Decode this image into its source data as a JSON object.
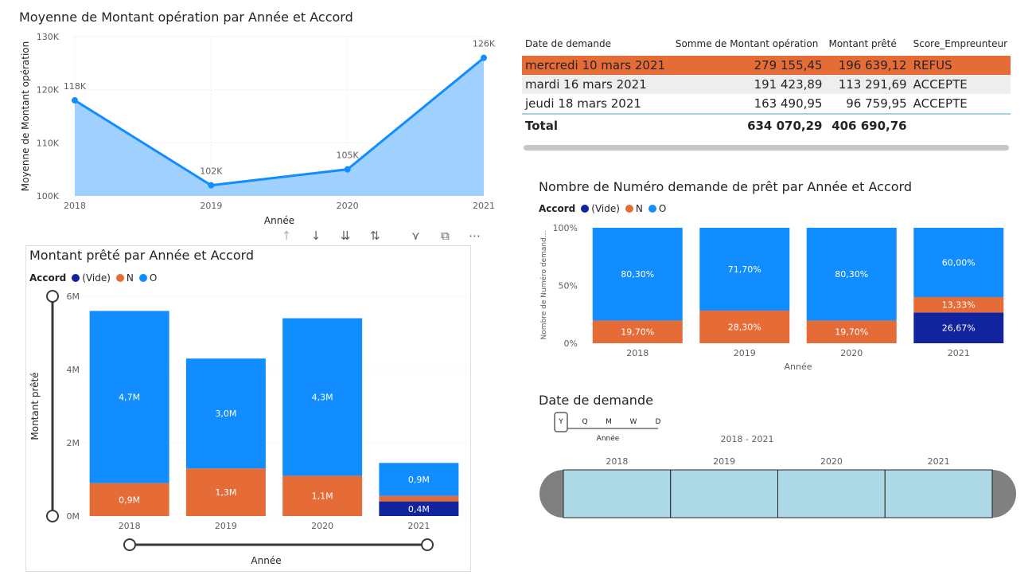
{
  "colors": {
    "series_o": "#118dff",
    "series_n": "#e66c37",
    "series_vide": "#12239e",
    "area_fill": "#9fd0fe",
    "line": "#118dff",
    "highlight_row": "#e66c37",
    "alt_row": "#eeeeee",
    "timeline_fill": "#add8e6"
  },
  "line_chart": {
    "title": "Moyenne de Montant opération par Année et Accord",
    "chart_data": {
      "type": "area",
      "title": "Moyenne de Montant opération par Année et Accord",
      "xlabel": "Année",
      "ylabel": "Moyenne de Montant opération",
      "x": [
        "2018",
        "2019",
        "2020",
        "2021"
      ],
      "values": [
        118000,
        102000,
        105000,
        126000
      ],
      "data_labels": [
        "118K",
        "102K",
        "105K",
        "126K"
      ],
      "y_ticks": [
        "100K",
        "110K",
        "120K",
        "130K"
      ],
      "ylim": [
        100000,
        130000
      ],
      "grid": true
    }
  },
  "matrix": {
    "headers": [
      "Date de demande",
      "Somme de Montant opération",
      "Montant prêté",
      "Score_Empreunteur"
    ],
    "rows": [
      {
        "date": "mercredi 10 mars 2021",
        "somme": "279 155,45",
        "prete": "196 639,12",
        "score": "REFUS"
      },
      {
        "date": "mardi 16 mars 2021",
        "somme": "191 423,89",
        "prete": "113 291,69",
        "score": "ACCEPTE"
      },
      {
        "date": "jeudi 18 mars 2021",
        "somme": "163 490,95",
        "prete": "96 759,95",
        "score": "ACCEPTE"
      }
    ],
    "total": {
      "label": "Total",
      "somme": "634 070,29",
      "prete": "406 690,76"
    }
  },
  "bar_chart": {
    "title": "Montant prêté par Année et Accord",
    "legend": {
      "title": "Accord",
      "items": [
        "(Vide)",
        "N",
        "O"
      ]
    },
    "toolbar_icons": [
      "drill-up-icon",
      "drill-down-icon",
      "expand-all-icon",
      "expand-hierarchy-icon",
      "filter-icon",
      "focus-mode-icon",
      "more-options-icon"
    ],
    "chart_data": {
      "type": "bar",
      "stacked": true,
      "title": "Montant prêté par Année et Accord",
      "xlabel": "Année",
      "ylabel": "Montant prêté",
      "categories": [
        "2018",
        "2019",
        "2020",
        "2021"
      ],
      "series": [
        {
          "name": "(Vide)",
          "values": [
            0,
            0,
            0,
            0.4
          ],
          "labels": [
            "",
            "",
            "",
            "0,4M"
          ]
        },
        {
          "name": "N",
          "values": [
            0.9,
            1.3,
            1.1,
            0.15
          ],
          "labels": [
            "0,9M",
            "1,3M",
            "1,1M",
            ""
          ]
        },
        {
          "name": "O",
          "values": [
            4.7,
            3.0,
            4.3,
            0.9
          ],
          "labels": [
            "4,7M",
            "3,0M",
            "4,3M",
            "0,9M"
          ]
        }
      ],
      "y_ticks": [
        "0M",
        "2M",
        "4M",
        "6M"
      ],
      "ylim": [
        0,
        6
      ],
      "grid": true
    }
  },
  "pct_chart": {
    "title": "Nombre de Numéro demande de prêt par Année et Accord",
    "legend": {
      "title": "Accord",
      "items": [
        "(Vide)",
        "N",
        "O"
      ]
    },
    "chart_data": {
      "type": "bar",
      "stacked_percent": true,
      "title": "Nombre de Numéro demande de prêt par Année et Accord",
      "xlabel": "Année",
      "ylabel": "Nombre de Numéro demand...",
      "categories": [
        "2018",
        "2019",
        "2020",
        "2021"
      ],
      "series": [
        {
          "name": "(Vide)",
          "values": [
            0,
            0,
            0,
            26.67
          ],
          "labels": [
            "",
            "",
            "",
            "26,67%"
          ]
        },
        {
          "name": "N",
          "values": [
            19.7,
            28.3,
            19.7,
            13.33
          ],
          "labels": [
            "19,70%",
            "28,30%",
            "19,70%",
            "13,33%"
          ]
        },
        {
          "name": "O",
          "values": [
            80.3,
            71.7,
            80.3,
            60.0
          ],
          "labels": [
            "80,30%",
            "71,70%",
            "80,30%",
            "60,00%"
          ]
        }
      ],
      "y_ticks": [
        "0%",
        "50%",
        "100%"
      ],
      "ylim": [
        0,
        100
      ]
    }
  },
  "timeline": {
    "title": "Date de demande",
    "granularity": [
      "Y",
      "Q",
      "M",
      "W",
      "D"
    ],
    "granularity_selected": "Y",
    "granularity_label": "Année",
    "range_label": "2018 - 2021",
    "years": [
      "2018",
      "2019",
      "2020",
      "2021"
    ]
  }
}
